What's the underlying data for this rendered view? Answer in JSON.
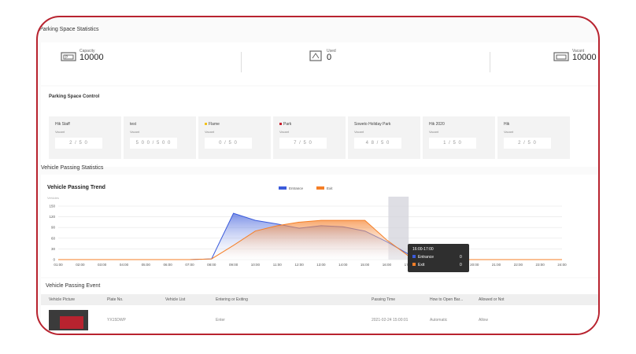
{
  "parking": {
    "title": "Parking Space Statistics",
    "capacity": {
      "label": "Capacity",
      "value": "10000"
    },
    "used": {
      "label": "Used",
      "value": "0"
    },
    "vacant": {
      "label": "Vacant",
      "value": "10000"
    }
  },
  "control": {
    "title": "Parking Space Control",
    "cards": [
      {
        "name": "Hik Staff",
        "label": "Vacant",
        "value": "2 / 5 0",
        "color": ""
      },
      {
        "name": "test",
        "label": "Vacant",
        "value": "5 0 0 / 5 0 0",
        "color": ""
      },
      {
        "name": "Flame",
        "label": "Vacant",
        "value": "0 / 5 0",
        "color": "#f2c21b"
      },
      {
        "name": "Park",
        "label": "Vacant",
        "value": "7 / 5 0",
        "color": "#c8202e"
      },
      {
        "name": "Soweto Holiday Park",
        "label": "Vacant",
        "value": "4 8 / 5 0",
        "color": ""
      },
      {
        "name": "Hik 2020",
        "label": "Vacant",
        "value": "1 / 5 0",
        "color": ""
      },
      {
        "name": "Hik",
        "label": "Vacant",
        "value": "2 / 5 0",
        "color": ""
      }
    ]
  },
  "passing": {
    "title": "Vehicle Passing Statistics"
  },
  "chart_data": {
    "type": "area",
    "title": "Vehicle Passing Trend",
    "ylabel": "Vehicles",
    "ylim": [
      0,
      150
    ],
    "yticks": [
      "150",
      "120",
      "90",
      "60",
      "30",
      "0"
    ],
    "categories": [
      "01:00",
      "02:00",
      "03:00",
      "04:00",
      "05:00",
      "06:00",
      "07:00",
      "08:00",
      "09:00",
      "10:00",
      "11:00",
      "12:00",
      "13:00",
      "14:00",
      "15:00",
      "16:00",
      "17:00",
      "18:00",
      "19:00",
      "20:00",
      "21:00",
      "22:00",
      "23:00",
      "24:00"
    ],
    "series": [
      {
        "name": "Entrance",
        "color": "#3b5bdb",
        "values": [
          0,
          0,
          0,
          0,
          0,
          0,
          0,
          2,
          130,
          110,
          100,
          88,
          95,
          92,
          80,
          50,
          15,
          0,
          0,
          0,
          0,
          0,
          0,
          0
        ]
      },
      {
        "name": "Exit",
        "color": "#f57f27",
        "values": [
          0,
          0,
          0,
          0,
          0,
          0,
          0,
          2,
          40,
          80,
          95,
          105,
          110,
          110,
          110,
          55,
          10,
          0,
          0,
          0,
          0,
          0,
          0,
          0
        ]
      }
    ],
    "legend": "top-center",
    "grid": true,
    "tooltip": {
      "title": "16:00-17:00",
      "rows": [
        {
          "name": "Entrance",
          "value": "0"
        },
        {
          "name": "Exit",
          "value": "0"
        }
      ]
    }
  },
  "events": {
    "title": "Vehicle Passing Event",
    "columns": [
      "Vehicle Picture",
      "Plate No.",
      "Vehicle List",
      "Entering or Exiting",
      "Passing Time",
      "How to Open Bar...",
      "Allowed or Not"
    ],
    "rows": [
      {
        "plate": "YX15DWP",
        "list": "",
        "direction": "Enter",
        "time": "2021-02-24 15:00:01",
        "open": "Automatic",
        "allowed": "Allow"
      }
    ]
  }
}
